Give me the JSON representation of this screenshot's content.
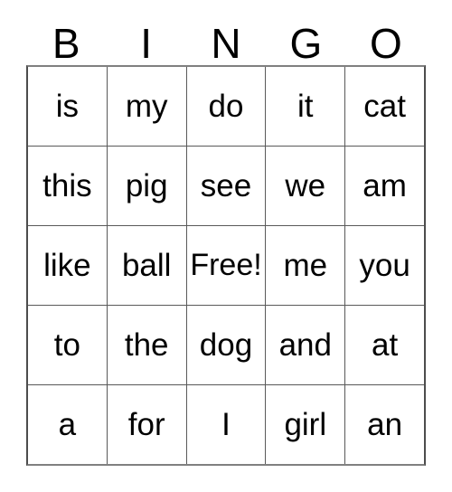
{
  "card": {
    "title": "BINGO",
    "header_letters": [
      "B",
      "I",
      "N",
      "G",
      "O"
    ],
    "free_space_label": "Free!",
    "colors": {
      "background": "#ffffff",
      "text": "#000000",
      "grid_line": "#595959",
      "outer_border": "#4d4d4d"
    },
    "rows": [
      {
        "cells": [
          "is",
          "my",
          "do",
          "it",
          "cat"
        ]
      },
      {
        "cells": [
          "this",
          "pig",
          "see",
          "we",
          "am"
        ]
      },
      {
        "cells": [
          "like",
          "ball",
          "Free!",
          "me",
          "you"
        ]
      },
      {
        "cells": [
          "to",
          "the",
          "dog",
          "and",
          "at"
        ]
      },
      {
        "cells": [
          "a",
          "for",
          "I",
          "girl",
          "an"
        ]
      }
    ]
  }
}
